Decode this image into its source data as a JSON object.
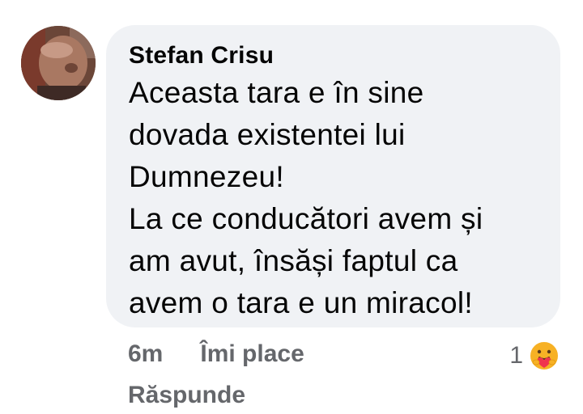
{
  "comment": {
    "author": "Stefan Crisu",
    "text": "Aceasta tara e în sine\ndovada existentei lui\nDumnezeu!\nLa ce conducători avem și\nam avut, însăși faptul ca\navem o tara e un miracol!",
    "avatar_icon": "profile-photo",
    "bubble_color": "#f0f2f5"
  },
  "actions": {
    "timestamp": "6m",
    "like_label": "Îmi place",
    "reply_label": "Răspunde"
  },
  "reactions": {
    "count": "1",
    "icon": "care-reaction-icon"
  }
}
